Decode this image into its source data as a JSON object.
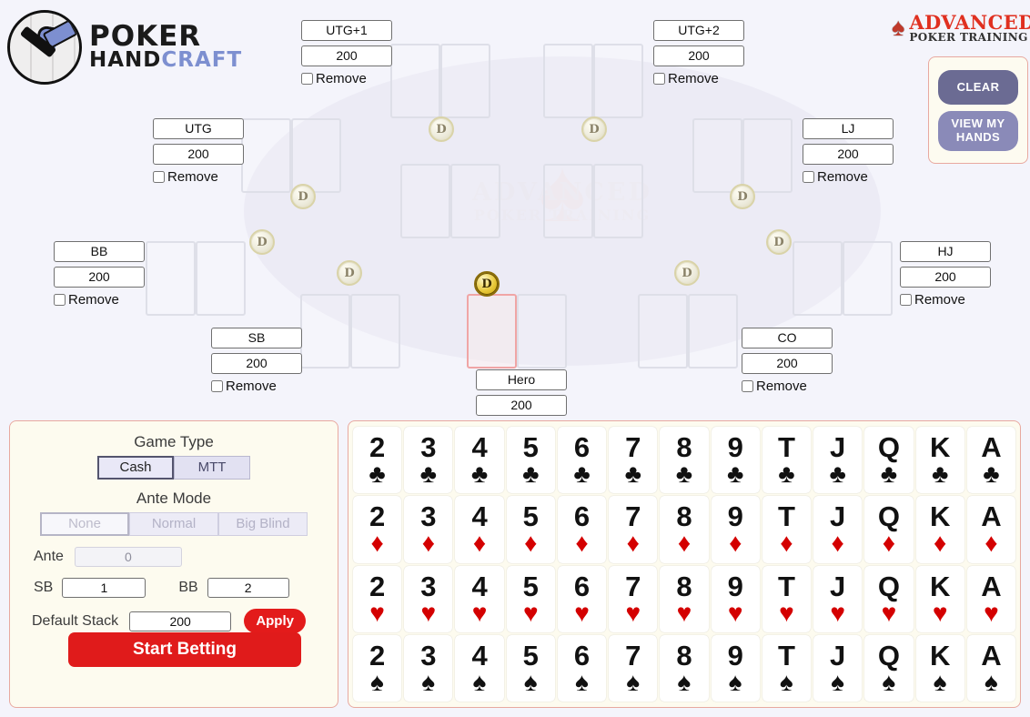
{
  "branding": {
    "left_logo": {
      "line1": "POKER",
      "line2_a": "HAND",
      "line2_b": "CRAFT",
      "icon": "hammer-cards-logo"
    },
    "right_logo": {
      "line1": "ADVANCED",
      "line2": "POKER TRAINING",
      "icon": "spade-icon"
    }
  },
  "actions": {
    "clear_label": "CLEAR",
    "view_hands_label": "VIEW MY HANDS"
  },
  "table": {
    "watermark_line1": "ADVANCED",
    "watermark_line2": "POKER TRAINING",
    "remove_label": "Remove",
    "dealer_label": "D",
    "seats": [
      {
        "id": "utg1",
        "name": "UTG+1",
        "stack": "200",
        "remove_label": "Remove"
      },
      {
        "id": "utg2",
        "name": "UTG+2",
        "stack": "200",
        "remove_label": "Remove"
      },
      {
        "id": "utg",
        "name": "UTG",
        "stack": "200",
        "remove_label": "Remove"
      },
      {
        "id": "lj",
        "name": "LJ",
        "stack": "200",
        "remove_label": "Remove"
      },
      {
        "id": "bb",
        "name": "BB",
        "stack": "200",
        "remove_label": "Remove"
      },
      {
        "id": "hj",
        "name": "HJ",
        "stack": "200",
        "remove_label": "Remove"
      },
      {
        "id": "sb",
        "name": "SB",
        "stack": "200",
        "remove_label": "Remove"
      },
      {
        "id": "co",
        "name": "CO",
        "stack": "200",
        "remove_label": "Remove"
      },
      {
        "id": "hero",
        "name": "Hero",
        "stack": "200",
        "remove_label": ""
      }
    ]
  },
  "settings": {
    "game_type_title": "Game Type",
    "game_type_options": [
      "Cash",
      "MTT"
    ],
    "game_type_selected": "Cash",
    "ante_mode_title": "Ante Mode",
    "ante_mode_options": [
      "None",
      "Normal",
      "Big Blind"
    ],
    "ante_mode_selected": "None",
    "ante_label": "Ante",
    "ante_value": "0",
    "sb_label": "SB",
    "sb_value": "1",
    "bb_label": "BB",
    "bb_value": "2",
    "default_stack_label": "Default Stack",
    "default_stack_value": "200",
    "apply_label": "Apply",
    "start_betting_label": "Start Betting"
  },
  "card_grid": {
    "ranks": [
      "2",
      "3",
      "4",
      "5",
      "6",
      "7",
      "8",
      "9",
      "T",
      "J",
      "Q",
      "K",
      "A"
    ],
    "suits": [
      {
        "name": "clubs",
        "glyph": "♣",
        "color": "black"
      },
      {
        "name": "diamonds",
        "glyph": "♦",
        "color": "red"
      },
      {
        "name": "hearts",
        "glyph": "♥",
        "color": "red"
      },
      {
        "name": "spades",
        "glyph": "♠",
        "color": "black"
      }
    ]
  },
  "colors": {
    "accent_red": "#e01b1b",
    "purple": "#6b6b93",
    "panel_border": "#e8a9a0",
    "background": "#f4f4fb"
  }
}
